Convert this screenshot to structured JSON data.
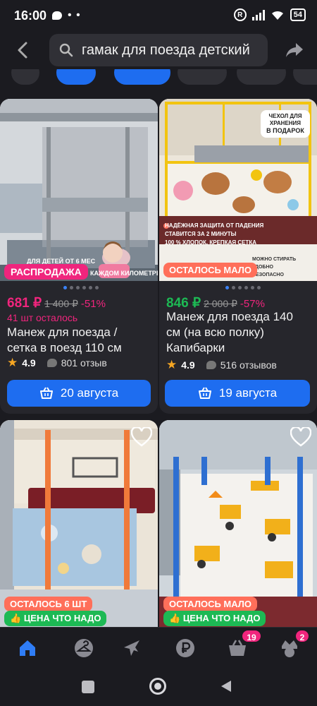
{
  "status": {
    "time": "16:00",
    "dots": "• •",
    "reg": "R",
    "battery": "54"
  },
  "search": {
    "query": "гамак для поезда детский"
  },
  "products": [
    {
      "badge_top": "ДЛЯ ДЕТЕЙ ОТ 6 МЕС",
      "badge_sale": "РАСПРОДАЖА",
      "img_caption": "КАЖДОМ КИЛОМЕТРЕ",
      "price": "681 ₽",
      "old_price": "1 400 ₽",
      "discount": "-51%",
      "stock": "41 шт осталось",
      "title_line1": "Манеж для поезда /",
      "title_line2": "сетка в поезд 110 см",
      "rating": "4.9",
      "reviews": "801 отзыв",
      "delivery": "20 августа",
      "price_color": "#f0257d"
    },
    {
      "badge_top": "ЧЕХОЛ ДЛЯ ХРАНЕНИЯ",
      "badge_gift": "В ПОДАРОК",
      "feature1": "НАДЁЖНАЯ ЗАЩИТА ОТ ПАДЕНИЯ",
      "feature2": "СТАВИТСЯ ЗА 2 МИНУТЫ",
      "feature3": "100 % ХЛОПОК, КРЕПКАЯ СЕТКА",
      "feature4": "МОЖНО СТИРАТЬ",
      "feature5": "УДОБНО",
      "feature6": "БЕЗОПАСНО",
      "badge_left": "ОСТАЛОСЬ МАЛО",
      "price": "846 ₽",
      "old_price": "2 000 ₽",
      "discount": "-57%",
      "title_line1": "Манеж для поезда 140",
      "title_line2": "см (на всю полку)",
      "title_line3": "Капибарки",
      "rating": "4.9",
      "reviews": "516 отзывов",
      "delivery": "19 августа",
      "price_color": "#1db954"
    },
    {
      "badge_left": "ОСТАЛОСЬ 6 ШТ",
      "badge_price": "ЦЕНА ЧТО НАДО"
    },
    {
      "badge_left": "ОСТАЛОСЬ МАЛО",
      "badge_price": "ЦЕНА ЧТО НАДО"
    }
  ],
  "nav": {
    "cart_count": "19",
    "profile_count": "2"
  },
  "colors": {
    "accent": "#1e6df0",
    "sale": "#f0257d",
    "good_price": "#1db954",
    "low_stock": "#ff6f5a"
  }
}
